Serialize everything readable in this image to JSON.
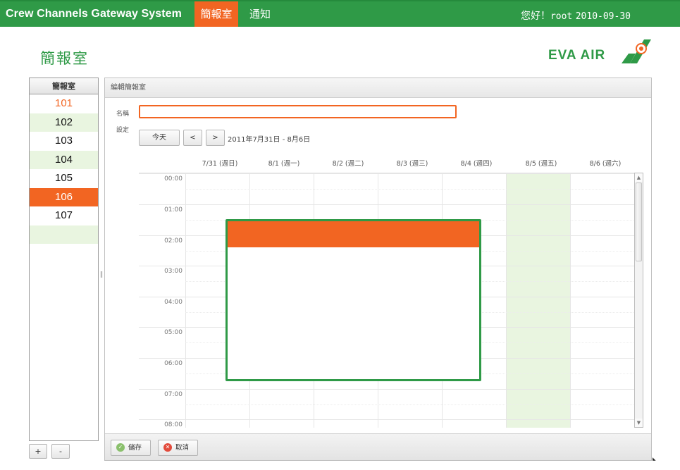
{
  "app": {
    "title": "Crew Channels Gateway System",
    "nav": {
      "active": "簡報室",
      "other": "通知"
    },
    "greeting": "您好！",
    "user": "root",
    "date": "2010-09-30"
  },
  "page": {
    "title": "簡報室",
    "logo_text": "EVA AIR"
  },
  "rooms": {
    "header": "簡報室",
    "items": [
      "101",
      "102",
      "103",
      "104",
      "105",
      "106",
      "107"
    ],
    "selected": "106",
    "add_label": "+",
    "remove_label": "-"
  },
  "editor": {
    "header": "編輯簡報室",
    "name_label": "名稱",
    "name_value": "",
    "settings_label": "設定",
    "today_label": "今天",
    "prev_label": "<",
    "next_label": ">",
    "date_range": "2011年7月31日 - 8月6日",
    "days": [
      "7/31 (週日)",
      "8/1 (週一)",
      "8/2 (週二)",
      "8/3 (週三)",
      "8/4 (週四)",
      "8/5 (週五)",
      "8/6 (週六)"
    ],
    "highlighted_day": "8/5 (週五)",
    "hours": [
      "00:00",
      "01:00",
      "02:00",
      "03:00",
      "04:00",
      "05:00",
      "06:00",
      "07:00",
      "08:00"
    ],
    "save_label": "儲存",
    "cancel_label": "取消"
  },
  "colors": {
    "brand_green": "#2f9a47",
    "accent_orange": "#f26522",
    "row_alt_green": "#e9f5e0"
  },
  "icons": {
    "save": "check-circle-icon",
    "cancel": "x-circle-icon",
    "logo": "eva-air-logo"
  }
}
